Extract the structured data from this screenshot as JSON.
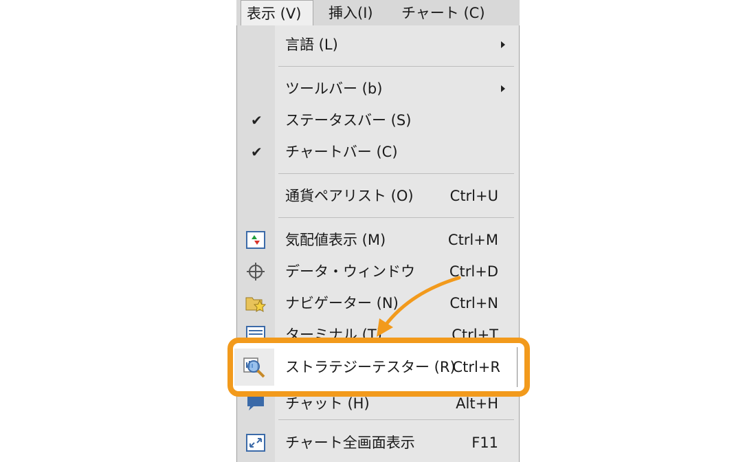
{
  "menubar": {
    "items": [
      {
        "label": "表示 (V)"
      },
      {
        "label": "挿入(I)"
      },
      {
        "label": "チャート (C)"
      }
    ]
  },
  "menu": {
    "language": {
      "label": "言語 (L)"
    },
    "toolbar": {
      "label": "ツールバー (b)"
    },
    "statusbar": {
      "label": "ステータスバー (S)",
      "checked": true
    },
    "chartbar": {
      "label": "チャートバー (C)",
      "checked": true
    },
    "symbols": {
      "label": "通貨ペアリスト (O)",
      "shortcut": "Ctrl+U"
    },
    "market_watch": {
      "label": "気配値表示 (M)",
      "shortcut": "Ctrl+M"
    },
    "data_window": {
      "label": "データ・ウィンドウ",
      "shortcut": "Ctrl+D"
    },
    "navigator": {
      "label": "ナビゲーター (N)",
      "shortcut": "Ctrl+N"
    },
    "terminal": {
      "label": "ターミナル (T)",
      "shortcut": "Ctrl+T"
    },
    "strategy_tester": {
      "label": "ストラテジーテスター (R)",
      "shortcut": "Ctrl+R"
    },
    "chat": {
      "label": "チャット (H)",
      "shortcut": "Alt+H"
    },
    "fullscreen": {
      "label": "チャート全画面表示",
      "shortcut": "F11"
    }
  },
  "colors": {
    "highlight": "#f29a1c",
    "menu_bg": "#e6e6e6"
  }
}
